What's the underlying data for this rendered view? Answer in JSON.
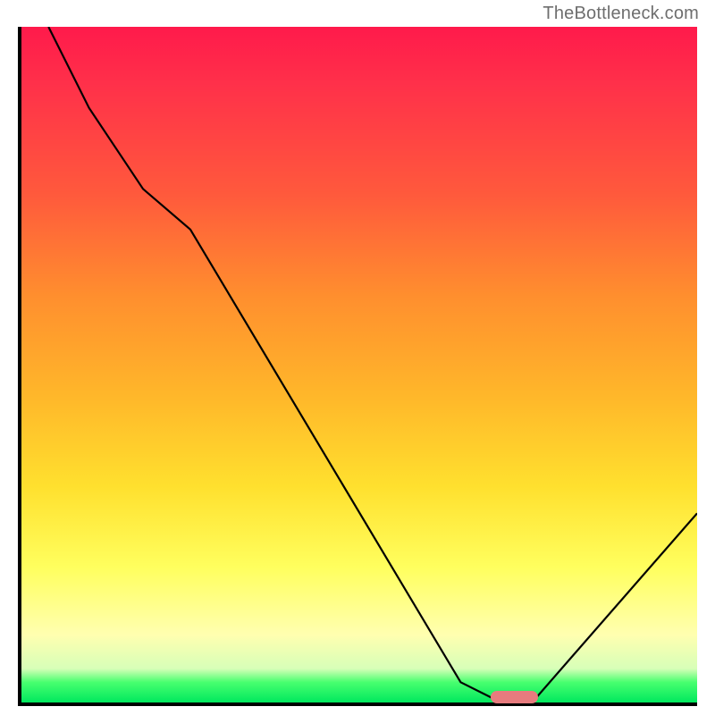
{
  "watermark": "TheBottleneck.com",
  "colors": {
    "axis": "#000000",
    "curve": "#000000",
    "marker": "#e77b7e",
    "gradient_stops": [
      "#ff1a4b",
      "#ff2f4a",
      "#ff5a3c",
      "#ff8f2e",
      "#ffb82a",
      "#ffe02e",
      "#ffff5e",
      "#ffffb0",
      "#d7ffb8",
      "#48ff6f",
      "#00e85e"
    ]
  },
  "chart_data": {
    "type": "line",
    "title": "",
    "xlabel": "",
    "ylabel": "",
    "xlim": [
      0,
      100
    ],
    "ylim": [
      0,
      100
    ],
    "grid": false,
    "legend": false,
    "series": [
      {
        "name": "bottleneck-curve",
        "x": [
          4,
          10,
          18,
          25,
          65,
          70,
          76,
          100
        ],
        "y": [
          100,
          88,
          76,
          70,
          3,
          0.5,
          0.5,
          28
        ]
      }
    ],
    "marker": {
      "x_center": 73,
      "y": 0.5,
      "width_pct": 7
    }
  }
}
